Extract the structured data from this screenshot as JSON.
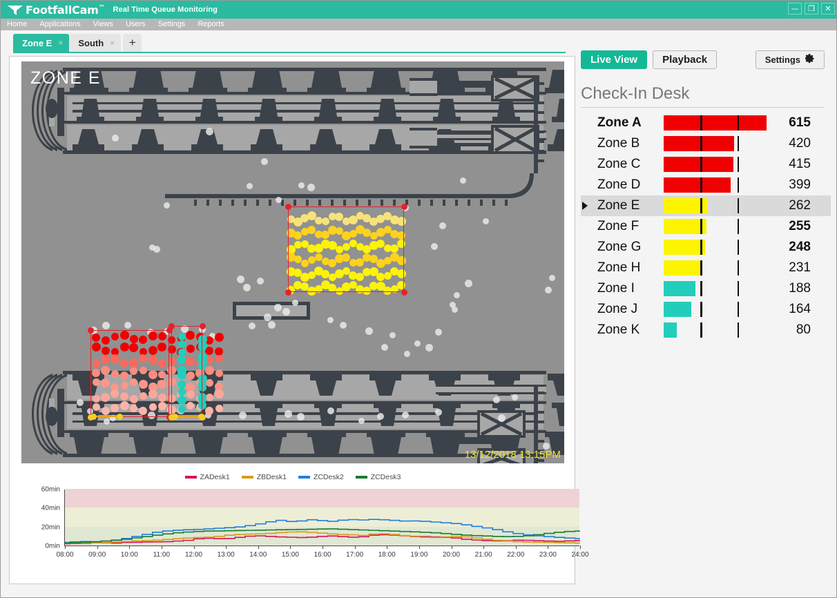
{
  "window": {
    "brand": "FootfallCam",
    "brand_tm": "™",
    "app_subtitle": "Real Time Queue Monitoring",
    "minimize_label": "—",
    "maximize_label": "❐",
    "close_label": "✕",
    "accent_color": "#2bbba0"
  },
  "menu": {
    "items": [
      {
        "label": "Home"
      },
      {
        "label": "Applications"
      },
      {
        "label": "Views"
      },
      {
        "label": "Users"
      },
      {
        "label": "Settings"
      },
      {
        "label": "Reports"
      }
    ]
  },
  "tabs": {
    "items": [
      {
        "label": "Zone E",
        "close": "×",
        "active": true
      },
      {
        "label": "South",
        "close": "×",
        "active": false
      }
    ],
    "add_label": "+"
  },
  "layout_icons": [
    {
      "name": "layout-single-icon",
      "selected": true
    },
    {
      "name": "layout-2x2-icon",
      "selected": false
    },
    {
      "name": "layout-3x3-icon",
      "selected": false
    }
  ],
  "map": {
    "zone_label": "ZONE E",
    "timestamp": "13/12/2018 13:15PM",
    "background_color": "#919191",
    "plan_color": "#3c4249",
    "zone_outline_color": "#e8202a",
    "handle_color": "#e8202a",
    "handle_alt_color": "#f5cf22"
  },
  "controls": {
    "live_view_label": "Live View",
    "playback_label": "Playback",
    "settings_label": "Settings",
    "gear_icon": "gear-icon"
  },
  "panel": {
    "title": "Check-In Desk",
    "selected_zone": "Zone E",
    "bar_max": 660,
    "tick_values": [
      220,
      440
    ],
    "zones": [
      {
        "label": "Zone A",
        "value": 615,
        "color": "#f00000",
        "bold_label": true,
        "bold_value": true,
        "selected": false
      },
      {
        "label": "Zone B",
        "value": 420,
        "color": "#f00000",
        "bold_label": false,
        "bold_value": false,
        "selected": false
      },
      {
        "label": "Zone C",
        "value": 415,
        "color": "#f00000",
        "bold_label": false,
        "bold_value": false,
        "selected": false
      },
      {
        "label": "Zone D",
        "value": 399,
        "color": "#f00000",
        "bold_label": false,
        "bold_value": false,
        "selected": false
      },
      {
        "label": "Zone E",
        "value": 262,
        "color": "#fdf500",
        "bold_label": false,
        "bold_value": false,
        "selected": true
      },
      {
        "label": "Zone F",
        "value": 255,
        "color": "#fdf500",
        "bold_label": false,
        "bold_value": true,
        "selected": false
      },
      {
        "label": "Zone G",
        "value": 248,
        "color": "#fdf500",
        "bold_label": false,
        "bold_value": true,
        "selected": false
      },
      {
        "label": "Zone H",
        "value": 231,
        "color": "#fdf500",
        "bold_label": false,
        "bold_value": false,
        "selected": false
      },
      {
        "label": "Zone I",
        "value": 188,
        "color": "#22cebb",
        "bold_label": false,
        "bold_value": false,
        "selected": false
      },
      {
        "label": "Zone J",
        "value": 164,
        "color": "#22cebb",
        "bold_label": false,
        "bold_value": false,
        "selected": false
      },
      {
        "label": "Zone K",
        "value": 80,
        "color": "#22cebb",
        "bold_label": false,
        "bold_value": false,
        "selected": false
      }
    ]
  },
  "chart_data": {
    "type": "line",
    "title": "",
    "xlabel": "",
    "ylabel": "",
    "ylim": [
      0,
      60
    ],
    "xlim": [
      "08:00",
      "24:00"
    ],
    "grid": false,
    "legend_position": "top-center",
    "y_ticks": [
      0,
      20,
      40,
      60
    ],
    "y_tick_labels": [
      "0min",
      "20min",
      "40min",
      "60min"
    ],
    "x": [
      "08:00",
      "09:00",
      "10:00",
      "11:00",
      "12:00",
      "13:00",
      "14:00",
      "15:00",
      "16:00",
      "17:00",
      "18:00",
      "19:00",
      "20:00",
      "21:00",
      "22:00",
      "23:00",
      "24:00"
    ],
    "bands": [
      {
        "from": 40,
        "to": 60,
        "color": "#efd2d4",
        "name": "critical"
      },
      {
        "from": 20,
        "to": 40,
        "color": "#edeed6",
        "name": "warning"
      },
      {
        "from": 0,
        "to": 20,
        "color": "#e0e8d4",
        "name": "normal"
      }
    ],
    "series": [
      {
        "name": "ZADesk1",
        "color": "#d4145a",
        "values": [
          2.5,
          2.8,
          3.0,
          4.0,
          3.6,
          3.4,
          4.0,
          4.2,
          4.5,
          4.6,
          4.8,
          5.5,
          6.2,
          7.8,
          8.4,
          8.0,
          8.2,
          9.4,
          10.6,
          11.0,
          10.4,
          9.8,
          9.5,
          9.2,
          9.6,
          10.4,
          10.8,
          10.2,
          9.6,
          10.0,
          11.6,
          12.2,
          11.8,
          11.0,
          10.4,
          10.2,
          9.8,
          9.4,
          8.6,
          7.4,
          6.6,
          6.0,
          5.6,
          5.8,
          6.4,
          6.2,
          5.8,
          5.4,
          5.2,
          5.6,
          6.0
        ]
      },
      {
        "name": "ZBDesk1",
        "color": "#d99b16",
        "values": [
          3.0,
          3.2,
          3.4,
          3.6,
          3.8,
          4.4,
          5.0,
          5.6,
          6.0,
          6.4,
          7.2,
          8.0,
          8.6,
          9.2,
          9.6,
          10.4,
          11.6,
          12.4,
          12.8,
          13.2,
          13.6,
          14.4,
          15.0,
          15.2,
          14.6,
          13.8,
          13.0,
          12.4,
          12.0,
          11.4,
          12.8,
          13.2,
          12.4,
          11.2,
          10.0,
          9.4,
          9.2,
          9.8,
          10.4,
          9.8,
          8.8,
          7.4,
          6.2,
          5.4,
          4.8,
          4.4,
          4.2,
          4.0,
          3.8,
          3.6,
          3.4
        ]
      },
      {
        "name": "ZCDesk2",
        "color": "#1f7fe0",
        "values": [
          4.0,
          4.6,
          5.0,
          4.8,
          5.4,
          6.6,
          8.2,
          10.4,
          12.6,
          14.8,
          16.2,
          17.0,
          17.4,
          17.8,
          18.4,
          19.0,
          19.6,
          20.4,
          21.8,
          23.6,
          25.8,
          27.4,
          26.2,
          26.8,
          28.0,
          27.2,
          26.4,
          27.6,
          28.2,
          27.8,
          28.4,
          28.0,
          27.4,
          26.6,
          26.8,
          26.4,
          25.6,
          24.8,
          24.0,
          22.6,
          21.0,
          19.4,
          17.6,
          15.2,
          13.4,
          12.0,
          11.0,
          10.2,
          9.4,
          8.6,
          8.0
        ]
      },
      {
        "name": "ZCDesk3",
        "color": "#1a7a2e",
        "values": [
          3.4,
          3.8,
          4.2,
          4.6,
          5.4,
          6.2,
          7.4,
          8.8,
          10.2,
          11.8,
          13.0,
          14.2,
          15.0,
          15.6,
          16.0,
          16.2,
          16.4,
          16.6,
          16.8,
          17.0,
          17.2,
          17.4,
          17.6,
          17.8,
          18.0,
          18.2,
          18.4,
          18.0,
          17.6,
          17.2,
          16.8,
          16.4,
          16.0,
          15.6,
          15.2,
          14.8,
          14.2,
          13.4,
          12.6,
          11.8,
          11.2,
          10.8,
          10.4,
          10.2,
          10.4,
          11.0,
          12.2,
          13.6,
          14.8,
          15.6,
          16.0
        ]
      }
    ]
  }
}
